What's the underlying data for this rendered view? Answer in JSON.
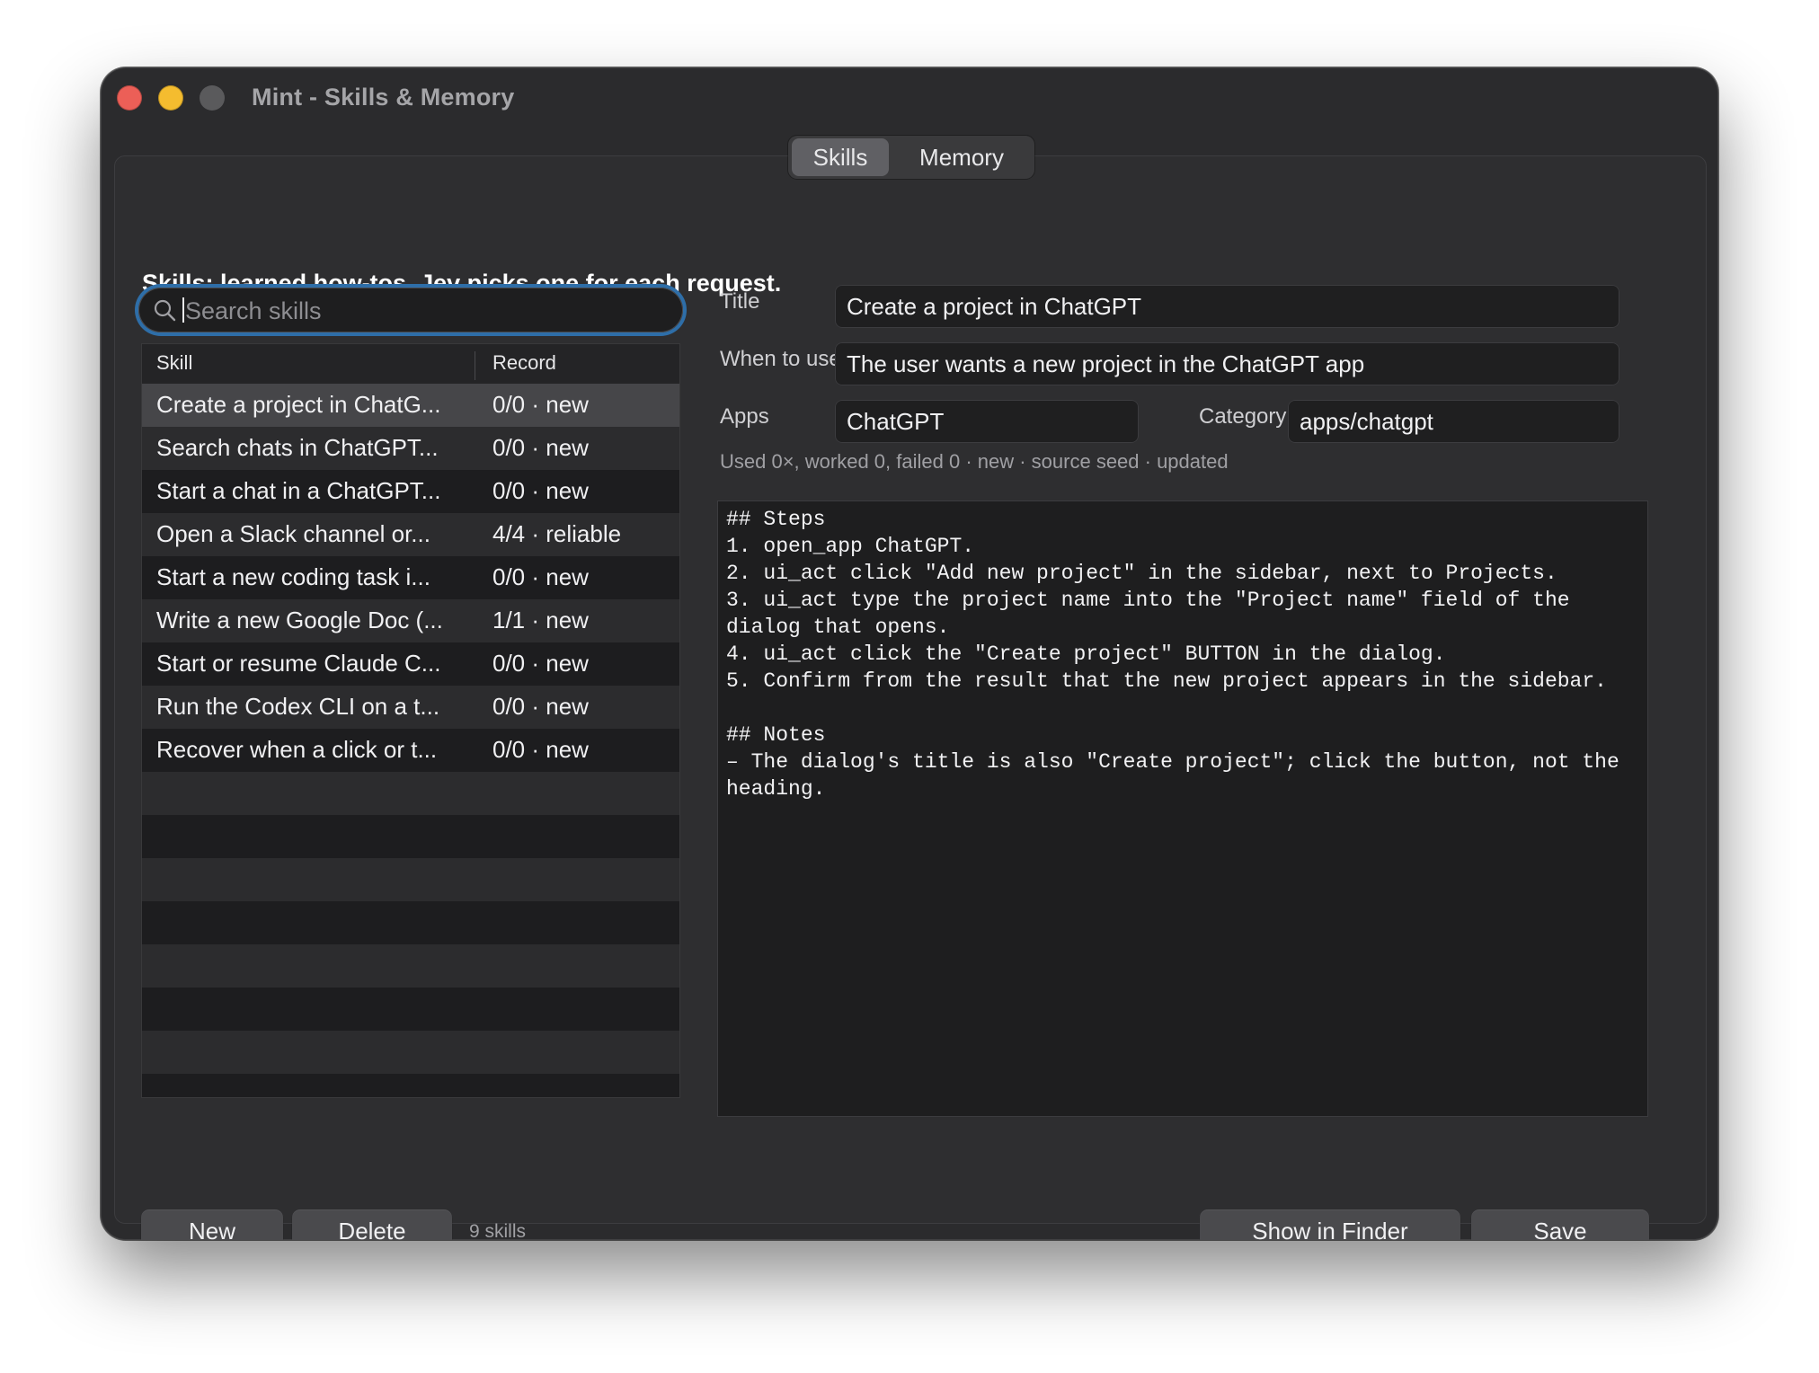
{
  "window": {
    "title": "Mint - Skills & Memory"
  },
  "tabs": [
    {
      "label": "Skills",
      "selected": true
    },
    {
      "label": "Memory",
      "selected": false
    }
  ],
  "headline": "Skills: learned how-tos. Jev picks one for each request.",
  "search": {
    "placeholder": "Search skills",
    "value": ""
  },
  "table": {
    "columns": [
      "Skill",
      "Record"
    ],
    "rows": [
      {
        "skill": "Create a project in ChatG...",
        "record": "0/0 · new",
        "selected": true
      },
      {
        "skill": "Search chats in ChatGPT...",
        "record": "0/0 · new"
      },
      {
        "skill": "Start a chat in a ChatGPT...",
        "record": "0/0 · new"
      },
      {
        "skill": "Open a Slack channel or...",
        "record": "4/4 · reliable"
      },
      {
        "skill": "Start a new coding task i...",
        "record": "0/0 · new"
      },
      {
        "skill": "Write a new Google Doc (...",
        "record": "1/1 · new"
      },
      {
        "skill": "Start or resume Claude C...",
        "record": "0/0 · new"
      },
      {
        "skill": "Run the Codex CLI on a t...",
        "record": "0/0 · new"
      },
      {
        "skill": "Recover when a click or t...",
        "record": "0/0 · new"
      }
    ]
  },
  "detail": {
    "title_label": "Title",
    "title_value": "Create a project in ChatGPT",
    "when_label": "When to use",
    "when_value": "The user wants a new project in the ChatGPT app",
    "apps_label": "Apps",
    "apps_value": "ChatGPT",
    "category_label": "Category",
    "category_value": "apps/chatgpt",
    "stats": "Used 0×, worked 0, failed 0 · new · source seed · updated",
    "body": "## Steps\n1. open_app ChatGPT.\n2. ui_act click \"Add new project\" in the sidebar, next to Projects.\n3. ui_act type the project name into the \"Project name\" field of the dialog that opens.\n4. ui_act click the \"Create project\" BUTTON in the dialog.\n5. Confirm from the result that the new project appears in the sidebar.\n\n## Notes\n– The dialog's title is also \"Create project\"; click the button, not the heading."
  },
  "footer": {
    "new_label": "New",
    "delete_label": "Delete",
    "count": "9 skills",
    "finder_label": "Show in Finder",
    "save_label": "Save"
  },
  "icons": {
    "search": "magnifier-icon"
  },
  "colors": {
    "accent_focus": "#2e6ea8",
    "close": "#ec5f57",
    "minimize": "#f4bc2f"
  }
}
